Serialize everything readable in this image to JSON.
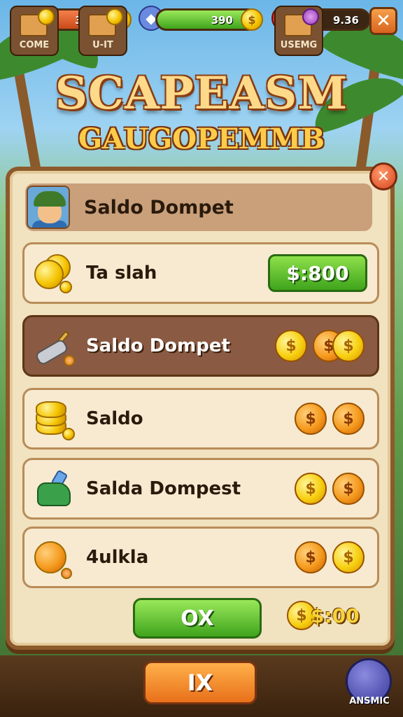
{
  "hud": {
    "bar1_value": "3100",
    "bar2_value": "390",
    "bar3_value": "9.36",
    "coin_symbol": "$",
    "close_symbol": "✕"
  },
  "title": {
    "line1": "SCAPEASM",
    "line2": "GAUGOPEMMB"
  },
  "panel": {
    "close_symbol": "✕",
    "header_label": "Saldo Dompet",
    "rows": [
      {
        "label": "Ta slah",
        "price": "$:800",
        "coins": []
      },
      {
        "label": "Saldo Dompet",
        "coins": [
          "gold",
          "orange",
          "gold"
        ]
      },
      {
        "label": "Saldo",
        "coins": [
          "orange",
          "orange"
        ]
      },
      {
        "label": "Salda Dompest",
        "coins": [
          "gold",
          "orange"
        ]
      },
      {
        "label": "4ulkla",
        "coins": [
          "orange",
          "gold"
        ]
      }
    ],
    "ok_label": "OX",
    "cost_value": "$:00"
  },
  "nav": {
    "item1": "COME",
    "item2": "U-IT",
    "center": "IX",
    "item3": "USEMG",
    "item4": "ANSMIC"
  },
  "colors": {
    "panel_bg": "#f1e2c0",
    "panel_border": "#8d5a2b",
    "selected_row": "#8a5a43",
    "green_button": "#3fa41c",
    "orange_button": "#e8701a"
  }
}
